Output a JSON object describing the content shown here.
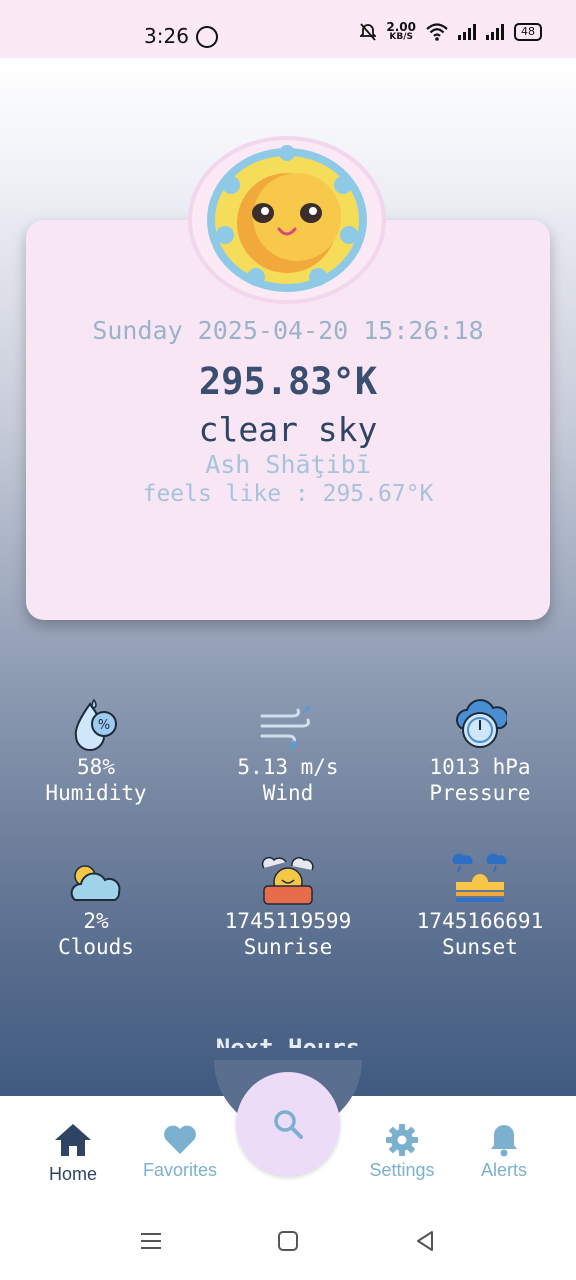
{
  "status_bar": {
    "time": "3:26",
    "net_speed_value": "2.00",
    "net_speed_unit": "KB/S",
    "battery": "48"
  },
  "weather": {
    "datetime": "Sunday 2025-04-20 15:26:18",
    "temperature": "295.83°K",
    "description": "clear sky",
    "city": "Ash Shāţibī",
    "feels_like": "feels like : 295.67°K"
  },
  "stats": [
    {
      "value": "58%",
      "label": "Humidity",
      "icon": "humidity-icon"
    },
    {
      "value": "5.13 m/s",
      "label": "Wind",
      "icon": "wind-icon"
    },
    {
      "value": "1013 hPa",
      "label": "Pressure",
      "icon": "pressure-icon"
    },
    {
      "value": "2%",
      "label": "Clouds",
      "icon": "clouds-icon"
    },
    {
      "value": "1745119599",
      "label": "Sunrise",
      "icon": "sunrise-icon"
    },
    {
      "value": "1745166691",
      "label": "Sunset",
      "icon": "sunset-icon"
    }
  ],
  "next_hours_title": "Next Hours",
  "nav": {
    "home": "Home",
    "favorites": "Favorites",
    "settings": "Settings",
    "alerts": "Alerts"
  },
  "colors": {
    "card": "#f8e6f5",
    "accent": "#3a4f70",
    "nav_active": "#2f4463",
    "nav_inactive": "#7bb0cf",
    "fab": "#ecdcf8"
  }
}
